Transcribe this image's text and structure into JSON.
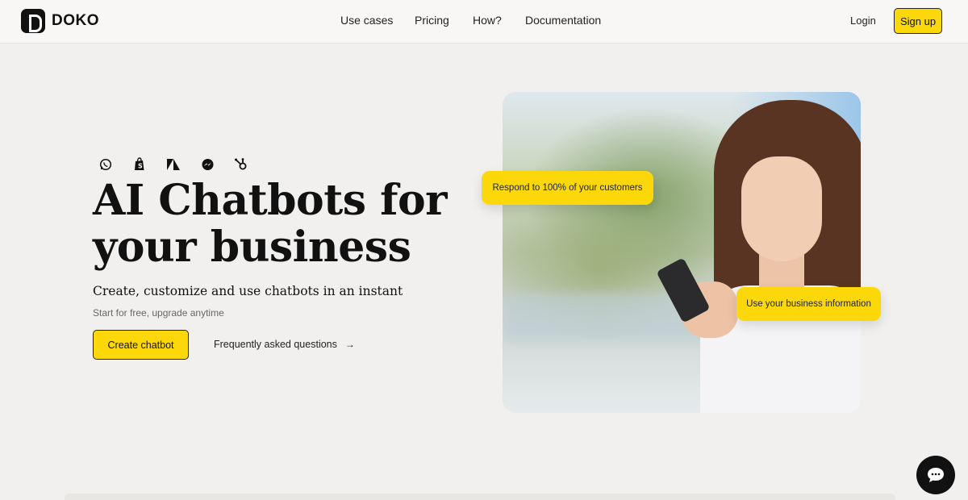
{
  "brand": {
    "name": "DOKO"
  },
  "nav": {
    "items": [
      "Use cases",
      "Pricing",
      "How?",
      "Documentation"
    ],
    "login": "Login",
    "signup": "Sign up"
  },
  "hero": {
    "integrations": [
      "whatsapp-icon",
      "shopify-icon",
      "zendesk-icon",
      "messenger-icon",
      "hubspot-icon"
    ],
    "title": "AI Chatbots for your business",
    "subtitle": "Create, customize and use chatbots in an instant",
    "note": "Start for free, upgrade anytime",
    "cta": "Create chatbot",
    "faq": "Frequently asked questions",
    "bubbles": [
      "Respond to 100% of your customers",
      "Use your business information"
    ]
  },
  "colors": {
    "accent": "#fcd80a",
    "background": "#f1f0ee",
    "ink": "#111111"
  }
}
